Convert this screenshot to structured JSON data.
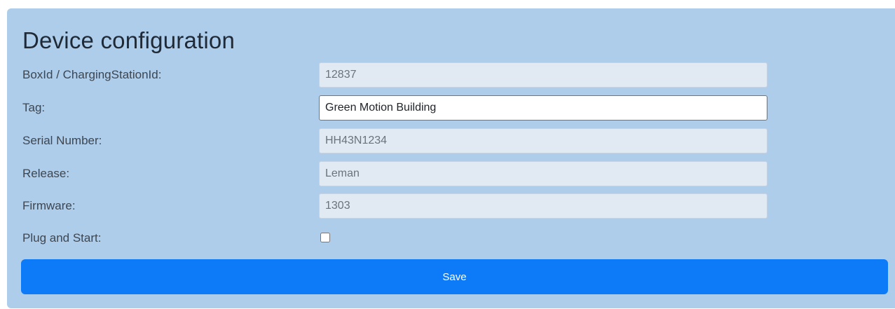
{
  "page": {
    "title": "Device configuration"
  },
  "fields": {
    "box_id": {
      "label": "BoxId / ChargingStationId:",
      "value": "12837"
    },
    "tag": {
      "label": "Tag:",
      "value": "Green Motion Building"
    },
    "serial_number": {
      "label": "Serial Number:",
      "value": "HH43N1234"
    },
    "release": {
      "label": "Release:",
      "value": "Leman"
    },
    "firmware": {
      "label": "Firmware:",
      "value": "1303"
    },
    "plug_and_start": {
      "label": "Plug and Start:",
      "checked": false
    }
  },
  "actions": {
    "save_label": "Save"
  },
  "colors": {
    "panel_background": "#aecdeb",
    "readonly_field": "#e1e9f3",
    "save_button": "#0d7bf7"
  }
}
